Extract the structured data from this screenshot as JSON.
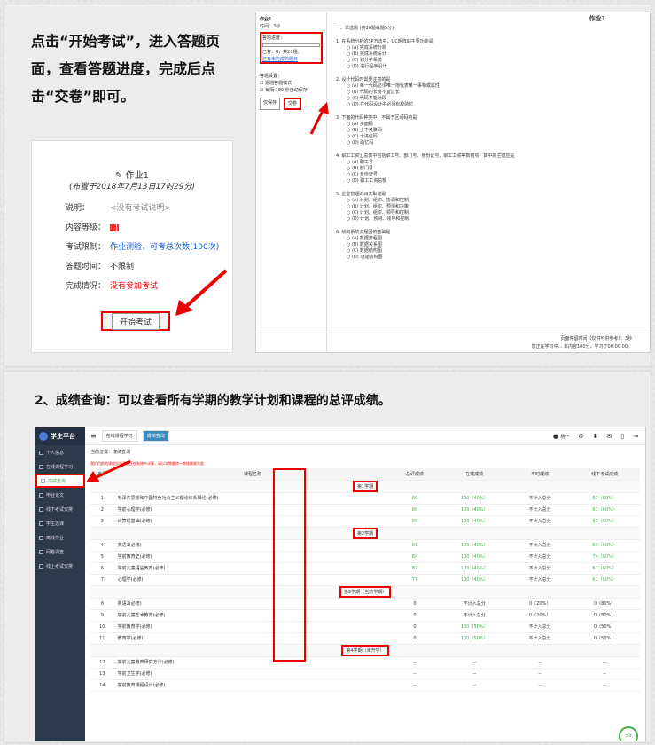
{
  "panel1": {
    "instruction": "点击“开始考试”，进入答题页面，查看答题进度，完成后点击“交卷”即可。",
    "exam_card": {
      "title": "作业1",
      "published": "(布置于2018年7月13日17时29分)",
      "rows": [
        {
          "label": "说明：",
          "value": "<没有考试说明>"
        },
        {
          "label": "内容等级：",
          "value": ""
        },
        {
          "label": "考试限制：",
          "value": "作业测验，可考总次数(100次)"
        },
        {
          "label": "答题时间：",
          "value": "不限制"
        },
        {
          "label": "完成情况：",
          "value": "没有参加考试"
        }
      ],
      "start_button": "开始考试"
    },
    "answer_page": {
      "title": "作业1",
      "time": "时间：3秒",
      "progress_label": "答题进度：",
      "progress_text": "已答：0，共20题。",
      "unanswered_link": "还有未完成的题目",
      "settings_label": "答题设置：",
      "setting1": "逐题答题模式",
      "setting2": "每隔 180 秒自动保存",
      "save_button": "仅保存",
      "submit_button": "交卷",
      "section": "一、单选题 (共20题每题5分)",
      "questions": [
        {
          "q": "1.  在系统分析的SP方法中，UC矩阵的主要功能是",
          "opts": [
            "(A) 完成系统分析",
            "(B) 完成系统设计",
            "(C) 划分子系统",
            "(D) 进行程序设计"
          ]
        },
        {
          "q": "2.  设计代码时需要注意的是",
          "opts": [
            "(A) 每一代码必须唯一地代表某一事物或属性",
            "(B) 代码的长度不宜过长",
            "(C) 代码不能分段",
            "(D) 在代码设计中必须有校验位"
          ]
        },
        {
          "q": "3.  下面的代码种类中，不属于区间码的是",
          "opts": [
            "(A) 多面码",
            "(B) 上下关联码",
            "(C) 十进位码",
            "(D) 助忆码"
          ]
        },
        {
          "q": "4.  职工工资汇总表中包括职工号、部门号、身份证号、职工工资等数据项，其中的主键应是",
          "opts": [
            "(A) 职工号",
            "(B) 部门号",
            "(C) 身份证号",
            "(D) 职工工资总额"
          ]
        },
        {
          "q": "5.  企业管理的四大职能是",
          "opts": [
            "(A) 计划、组织、协调和控制",
            "(B) 计划、组织、预测和决策",
            "(C) 计划、组织、领导和控制",
            "(D) 计划、预测、领导和控制"
          ]
        },
        {
          "q": "6.  绘制系统流程图的基础是",
          "opts": [
            "(A) 数据流程图",
            "(B) 数据关系图",
            "(C) 数据结构图",
            "(D) 功能结构图"
          ]
        }
      ],
      "footer1": "页面停留时间（仅供可供参考）：3秒",
      "footer2": "您正在学习中... 本内容100分，学习了00:00:00。"
    }
  },
  "panel2": {
    "heading": "2、成绩查询：可以查看所有学期的教学计划和课程的总评成绩。",
    "app": {
      "brand": "学生平台",
      "sidebar": [
        "个人信息",
        "在线课程学习",
        "成绩查询",
        "毕业论文",
        "线下考试安排",
        "学生选课",
        "离线作业",
        "问卷调查",
        "线上考试安排"
      ],
      "tabs": [
        "在线课程学习",
        "成绩查询"
      ],
      "user": "杨**",
      "breadcrumb": "当前位置：成绩查询",
      "notice": "我们目前的课程总评成绩正在系统中计算，请以学院最终一审核成绩为准",
      "columns": [
        "序号",
        "课程名称",
        "总评成绩",
        "在线成绩",
        "平时成绩",
        "线下考试成绩"
      ],
      "terms": [
        {
          "label": "第1学期",
          "rows": [
            [
              "1",
              "毛泽东思想和中国特色社会主义理论体系概论(必修)",
              "89",
              "100（40%）",
              "不计入总分",
              "82（60%）"
            ],
            [
              "2",
              "学前心理学(必修)",
              "89",
              "100（40%）",
              "不计入总分",
              "81（60%）"
            ],
            [
              "3",
              "计算机基础(必修)",
              "89",
              "100（40%）",
              "不计入总分",
              "82（60%）"
            ]
          ]
        },
        {
          "label": "第2学期",
          "rows": [
            [
              "4",
              "英语1(必修)",
              "81",
              "100（40%）",
              "不计入总分",
              "69（60%）"
            ],
            [
              "5",
              "学前教育史(必修)",
              "84",
              "100（40%）",
              "不计入总分",
              "74（60%）"
            ],
            [
              "6",
              "学前儿童语言教育(必修)",
              "82",
              "100（40%）",
              "不计入总分",
              "67（60%）"
            ],
            [
              "7",
              "心理学(必修)",
              "77",
              "100（40%）",
              "不计入总分",
              "61（60%）"
            ]
          ]
        },
        {
          "label": "第3学期（当前学期）",
          "rows": [
            [
              "8",
              "英语2(必修)",
              "0",
              "不计入总分",
              "0（20%）",
              "0（80%）"
            ],
            [
              "9",
              "学前儿童艺术教育(必修)",
              "0",
              "不计入总分",
              "0（20%）",
              "0（80%）"
            ],
            [
              "10",
              "学前教育学(必修)",
              "0",
              "100（50%）",
              "不计入总分",
              "0（50%）"
            ],
            [
              "11",
              "教育学(必修)",
              "0",
              "100（50%）",
              "不计入总分",
              "0（50%）"
            ]
          ]
        },
        {
          "label": "第4学期（未开学）",
          "rows": [
            [
              "12",
              "学前儿童教育研究方法(必修)",
              "--",
              "--",
              "--",
              "--"
            ],
            [
              "13",
              "学前卫生学(必修)",
              "--",
              "--",
              "--",
              "--"
            ],
            [
              "14",
              "学前教育课程设计(必修)",
              "--",
              "--",
              "--",
              "--"
            ]
          ]
        }
      ],
      "bubble": "59"
    }
  },
  "colors": {
    "red": "#ee0000",
    "green": "#4caf50",
    "sidebar": "#2d3a4b",
    "accent": "#3c8dbc"
  }
}
